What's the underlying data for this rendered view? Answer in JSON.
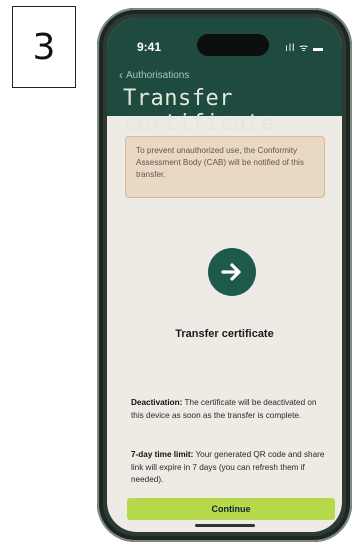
{
  "step_number": "3",
  "status_bar": {
    "time": "9:41",
    "icons": "ıll ᯤ ▬"
  },
  "nav": {
    "back_label": "Authorisations"
  },
  "page_title": "Transfer certificate",
  "notice": {
    "text": "To prevent unauthorized use, the Conformity Assessment Body (CAB) will be notified of this transfer."
  },
  "hero": {
    "icon": "arrow-right-icon",
    "title": "Transfer certificate"
  },
  "info": [
    {
      "label": "Deactivation:",
      "text": " The certificate will be deactivated on this device as soon as the transfer is complete."
    },
    {
      "label": "7-day time limit:",
      "text": " Your generated QR code and share link will expire in 7 days (you can refresh them if needed)."
    }
  ],
  "continue_label": "Continue",
  "colors": {
    "header_bg": "#1f4a3f",
    "accent": "#b5d94a",
    "notice_bg": "#e8d8c4",
    "icon_bg": "#1e5a4c"
  }
}
